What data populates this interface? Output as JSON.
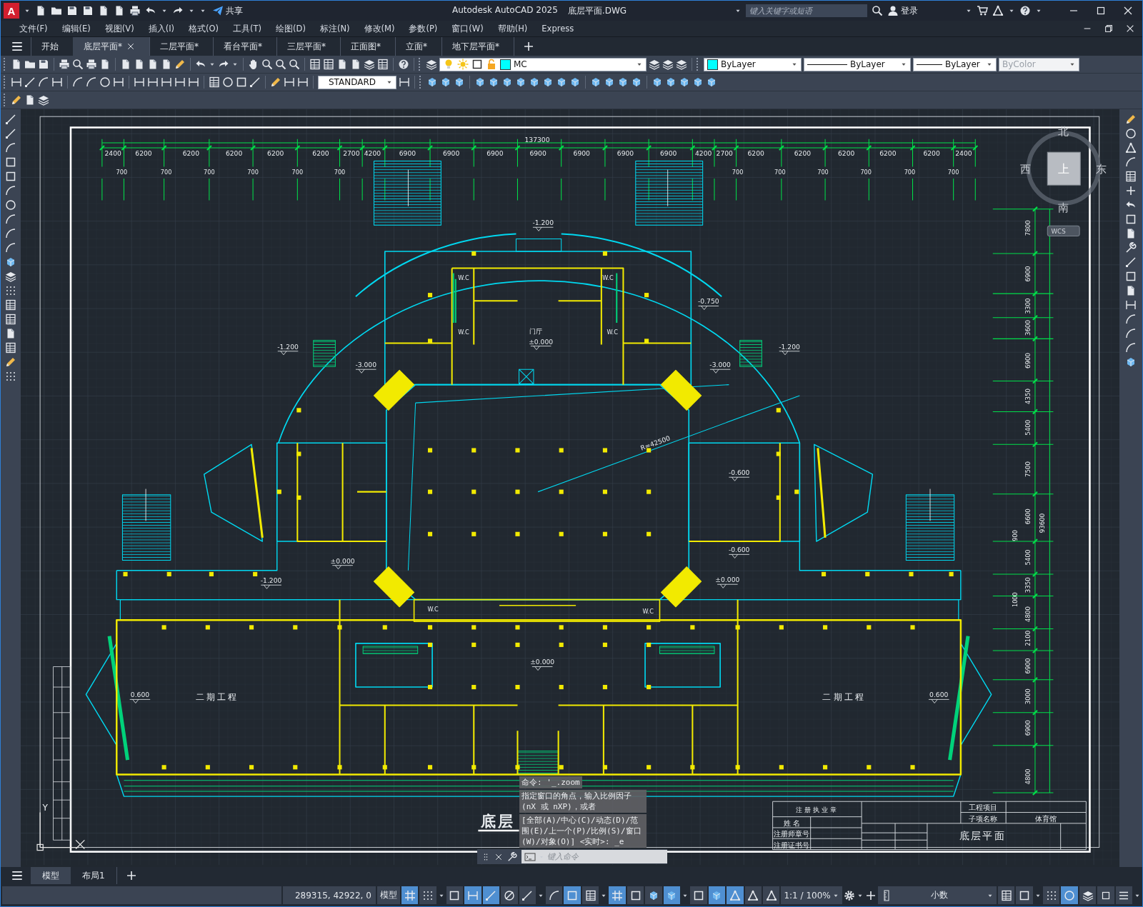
{
  "title_bar": {
    "logo": "A",
    "share": "共享",
    "app_title": "Autodesk AutoCAD 2025",
    "file_name": "底层平面.DWG",
    "search": {
      "placeholder": "键入关键字或短语"
    },
    "sign_in": "登录"
  },
  "menu": [
    "文件(F)",
    "编辑(E)",
    "视图(V)",
    "插入(I)",
    "格式(O)",
    "工具(T)",
    "绘图(D)",
    "标注(N)",
    "修改(M)",
    "参数(P)",
    "窗口(W)",
    "帮助(H)",
    "Express"
  ],
  "file_tabs": [
    {
      "label": "开始",
      "selected": false
    },
    {
      "label": "底层平面*",
      "selected": true
    },
    {
      "label": "二层平面*",
      "selected": false
    },
    {
      "label": "看台平面*",
      "selected": false
    },
    {
      "label": "三层平面*",
      "selected": false
    },
    {
      "label": "正面图*",
      "selected": false
    },
    {
      "label": "立面*",
      "selected": false
    },
    {
      "label": "地下层平面*",
      "selected": false
    }
  ],
  "toolbar": {
    "layer": "MC",
    "object_color": "ByLayer",
    "linetype": "ByLayer",
    "lineweight": "ByLayer",
    "plot_style": {
      "value": "ByColor",
      "disabled": true
    },
    "text_style": "STANDARD"
  },
  "drawing": {
    "overall_dimension": "137300",
    "top_dimensions": [
      "2400",
      "6200",
      "6200",
      "6200",
      "6200",
      "6200",
      "2700",
      "4200",
      "6900",
      "6900",
      "6900",
      "6900",
      "6900",
      "6900",
      "6900",
      "4200",
      "2700",
      "6200",
      "6200",
      "6200",
      "6200",
      "6200",
      "2400"
    ],
    "top_subdimensions": [
      "700",
      "700",
      "700",
      "700",
      "700",
      "700",
      "700",
      "700",
      "700",
      "700",
      "700",
      "700"
    ],
    "right_dimensions": [
      "7800",
      "6900",
      "3300",
      "3600",
      "6900",
      "4350",
      "5400",
      "7500",
      "6600",
      "5400",
      "3350",
      "4800",
      "2100",
      "6900",
      "3000",
      "6900",
      "4800"
    ],
    "right_total": "93600",
    "right_extra": [
      "900",
      "1000"
    ],
    "level_marks": [
      "-1.200",
      "-1.200",
      "-1.200",
      "-1.200",
      "-3.000",
      "-3.000",
      "-0.750",
      "-0.600",
      "-0.600",
      "±0.000",
      "±0.000",
      "±0.000",
      "±0.000",
      "0.600",
      "0.600"
    ],
    "radius_label": "R=42500",
    "wc_labels": [
      "W.C",
      "W.C",
      "W.C",
      "W.C",
      "W.C",
      "W.C"
    ],
    "hall_label": "门厅",
    "phase_two_labels": [
      "二期工程",
      "二期工程"
    ],
    "sheet_title": "底层",
    "ucs_label": "Y",
    "title_block": {
      "seal": "注 册 执 业 章",
      "name": "姓    名",
      "seal_number": "注册师章号",
      "certificate_number": "注册证书号",
      "project": "工程项目",
      "subproject": "子项名称",
      "subproject_value": "体育馆",
      "drawing_title": "底层平面"
    }
  },
  "viewcube": {
    "north": "北",
    "west": "西",
    "east": "东",
    "south": "南",
    "face": "上",
    "wcs": "WCS"
  },
  "command_line": {
    "history": [
      "命令: '_.zoom",
      "指定窗口的角点，输入比例因子 (nX 或 nXP)，或者",
      "[全部(A)/中心(C)/动态(D)/范围(E)/上一个(P)/比例(S)/窗口(W)/对象(O)] <实时>: _e"
    ],
    "placeholder": "键入命令"
  },
  "layout_tabs": [
    {
      "label": "模型",
      "selected": true
    },
    {
      "label": "布局1",
      "selected": false
    }
  ],
  "status_bar": {
    "coordinates": "289315, 42922, 0",
    "space": "模型",
    "toggles": [
      {
        "on": true
      },
      {
        "on": false
      },
      {
        "on": false
      },
      {
        "on": true
      },
      {
        "on": true
      },
      {
        "on": false
      },
      {
        "on": false
      },
      {
        "on": false
      },
      {
        "on": true
      },
      {
        "on": false
      },
      {
        "on": true
      },
      {
        "on": false
      },
      {
        "on": false
      },
      {
        "on": true
      },
      {
        "on": false
      },
      {
        "on": true
      },
      {
        "on": true
      },
      {
        "on": false
      },
      {
        "on": false
      }
    ],
    "scale": "1:1 / 100%",
    "units": "小数",
    "tail_toggles": [
      {
        "on": false
      },
      {
        "on": false
      },
      {
        "on": false
      },
      {
        "on": true
      },
      {
        "on": false
      },
      {
        "on": false
      },
      {
        "on": false
      }
    ]
  }
}
